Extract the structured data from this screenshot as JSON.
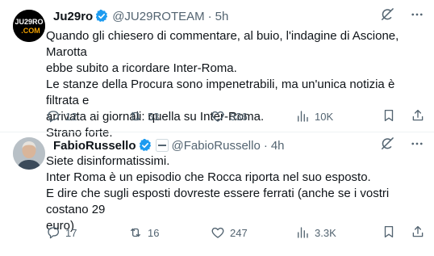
{
  "tweets": [
    {
      "avatar_text_top": "JU29RO",
      "avatar_text_bottom": ".COM",
      "name": "Ju29ro",
      "handle": "@JU29ROTEAM",
      "time": "5h",
      "lines": [
        "Quando gli chiesero di commentare, al buio, l'indagine di Ascione, Marotta",
        "ebbe subito a ricordare Inter-Roma.",
        "Le stanze della Procura sono impenetrabili, ma un'unica notizia è filtrata e",
        "arrivata ai giornali: quella su Inter-Roma.",
        "Strano forte."
      ],
      "replies": "12",
      "reposts": "53",
      "likes": "336",
      "views": "10K"
    },
    {
      "name": "FabioRussello",
      "handle": "@FabioRussello",
      "time": "4h",
      "lines": [
        "Siete disinformatissimi.",
        "Inter Roma è un episodio che Rocca riporta nel suo esposto.",
        "E dire che sugli esposti dovreste essere ferrati (anche se i vostri costano 29",
        "euro)"
      ],
      "replies": "17",
      "reposts": "16",
      "likes": "247",
      "views": "3.3K"
    }
  ],
  "separator": "·",
  "colors": {
    "verified": "#1d9bf0",
    "muted": "#536471",
    "text": "#0f1419"
  }
}
